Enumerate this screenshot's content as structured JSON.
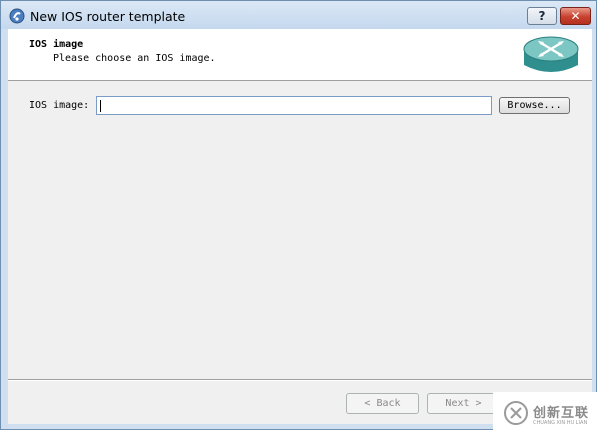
{
  "window": {
    "title": "New IOS router template",
    "help_label": "?",
    "close_label": "✕"
  },
  "header": {
    "title": "IOS image",
    "subtitle": "Please choose an IOS image."
  },
  "form": {
    "ios_image_label": "IOS image:",
    "ios_image_value": "",
    "browse_label": "Browse..."
  },
  "footer": {
    "back_label": "Back",
    "back_enabled": false,
    "next_label": "Next",
    "next_enabled": false
  },
  "watermark": {
    "text": "创新互联",
    "sub": "CHUANG XIN HU LIAN"
  },
  "icons": {
    "app": "app-icon",
    "router": "router-icon",
    "back": "chevron-left-icon",
    "next": "chevron-right-icon"
  },
  "colors": {
    "router_body": "#2f8f8f",
    "router_top": "#7cc7c4"
  }
}
